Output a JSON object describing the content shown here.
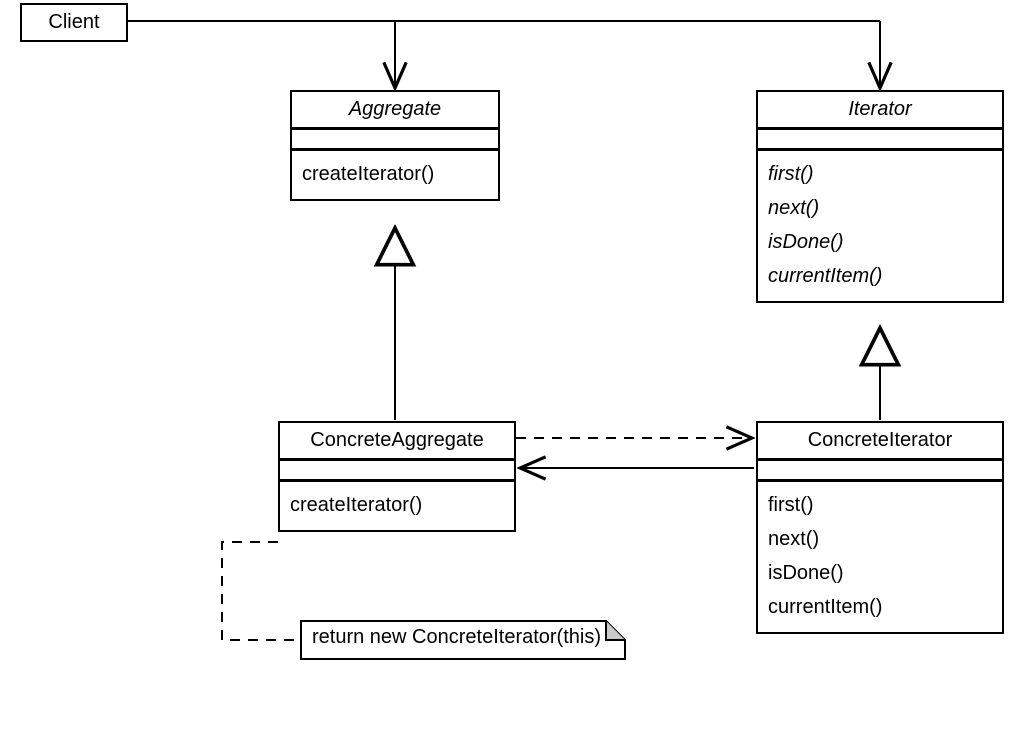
{
  "client": {
    "label": "Client"
  },
  "aggregate": {
    "name": "Aggregate",
    "ops": [
      "createIterator()"
    ]
  },
  "iterator": {
    "name": "Iterator",
    "ops": [
      "first()",
      "next()",
      "isDone()",
      "currentItem()"
    ]
  },
  "concreteAggregate": {
    "name": "ConcreteAggregate",
    "ops": [
      "createIterator()"
    ]
  },
  "concreteIterator": {
    "name": "ConcreteIterator",
    "ops": [
      "first()",
      "next()",
      "isDone()",
      "currentItem()"
    ]
  },
  "note": {
    "text": "return new ConcreteIterator(this)"
  }
}
